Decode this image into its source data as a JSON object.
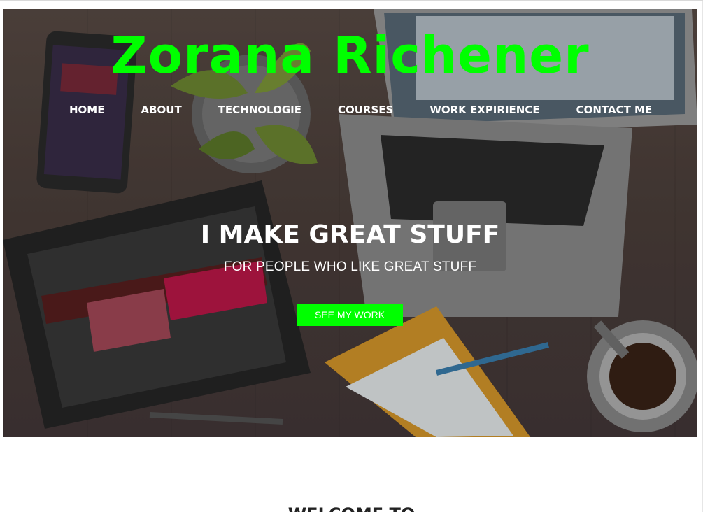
{
  "site": {
    "title": "Zorana Richener",
    "colors": {
      "accent": "#00ff00",
      "hero_text": "#ffffff"
    }
  },
  "nav": {
    "items": [
      {
        "label": "HOME"
      },
      {
        "label": "ABOUT"
      },
      {
        "label": "TECHNOLOGIE"
      },
      {
        "label": "COURSES"
      },
      {
        "label": "WORK EXPIRIENCE"
      },
      {
        "label": "CONTACT ME"
      }
    ]
  },
  "hero": {
    "heading": "I MAKE GREAT STUFF",
    "subheading": "FOR PEOPLE WHO LIKE GREAT STUFF",
    "cta_label": "SEE MY WORK"
  },
  "section": {
    "welcome_title": "WELCOME TO"
  }
}
